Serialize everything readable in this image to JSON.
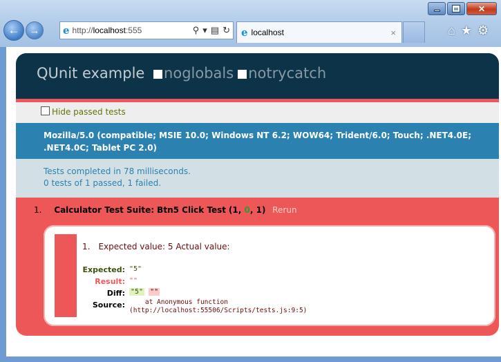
{
  "browser": {
    "address_prefix": "http://",
    "address_host": "localhost",
    "address_suffix": ":555",
    "tab_title": "localhost",
    "tab_close": "×"
  },
  "qunit": {
    "title": "QUnit example",
    "option_noglobals": "noglobals",
    "option_notrycatch": "notrycatch",
    "hide_passed_label": "Hide passed tests",
    "user_agent_line1": "Mozilla/5.0 (compatible; MSIE 10.0; Windows NT 6.2; WOW64; Trident/6.0; Touch; .NET4.0E;",
    "user_agent_line2": ".NET4.0C; Tablet PC 2.0)",
    "result_line1": "Tests completed in 78 milliseconds.",
    "result_line2": "0 tests of 1 passed, 1 failed.",
    "test": {
      "number": "1.",
      "name": "Calculator Test Suite: Btn5 Click Test",
      "counts_open": "(",
      "failed": "1",
      "sep1": ", ",
      "passed": "0",
      "sep2": ", ",
      "total": "1",
      "counts_close": ")",
      "rerun": "Rerun"
    },
    "assertion": {
      "number": "1.",
      "message": "Expected value: 5 Actual value:",
      "expected_label": "Expected:",
      "expected_value": "\"5\"",
      "result_label": "Result:",
      "result_value": "\"\"",
      "diff_label": "Diff:",
      "diff_inserted": "\"5\"",
      "diff_deleted": "\"\"",
      "source_label": "Source:",
      "source_line1": "    at Anonymous function",
      "source_line2": "(http://localhost:55506/Scripts/tests.js:9:5)"
    }
  },
  "colors": {
    "header_bg": "#0d3349",
    "fail_red": "#ee5757",
    "ua_blue": "#2b81af",
    "result_bg": "#d2e0e6"
  }
}
